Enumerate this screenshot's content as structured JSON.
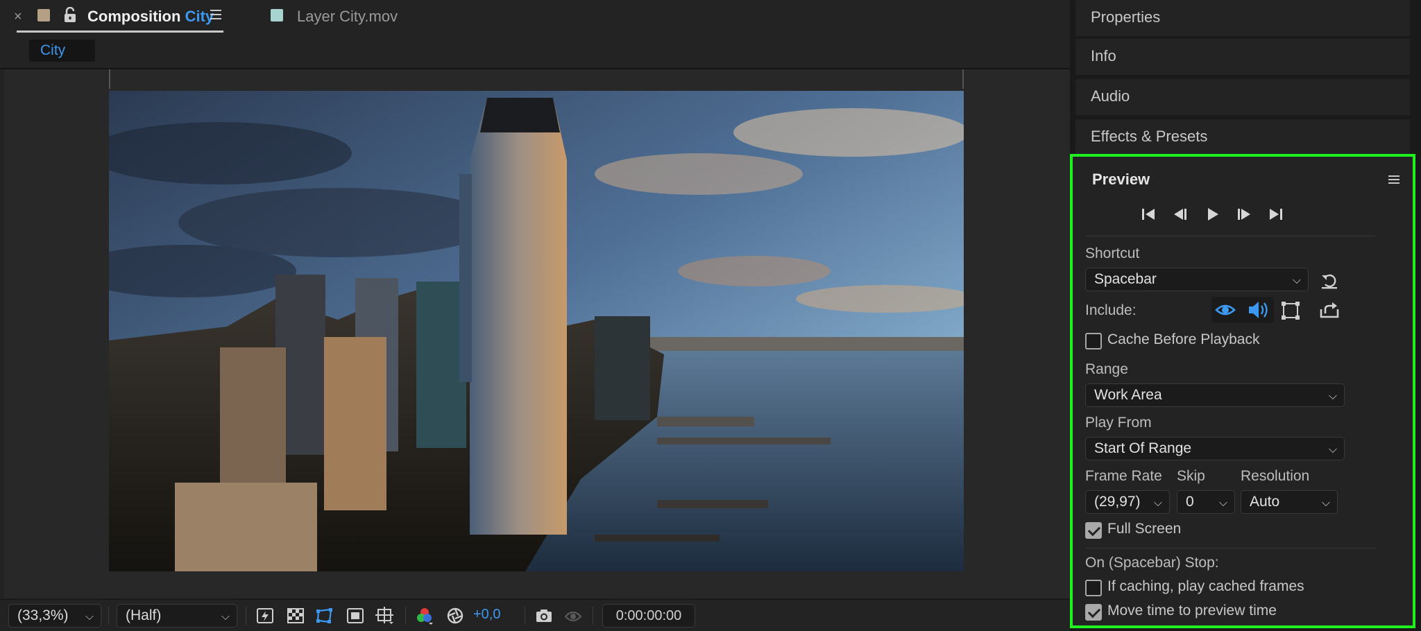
{
  "composition_tab": {
    "title_prefix": "Composition",
    "title_name": "City",
    "layer_tab_label": "Layer City.mov",
    "breadcrumb": "City"
  },
  "colors": {
    "accent_blue": "#3d98f0",
    "highlight_green": "#1ff01f",
    "comp_swatch": "#b4a084",
    "layer_swatch": "#a8d4d0"
  },
  "viewer_toolbar": {
    "magnification": "(33,3%)",
    "resolution": "(Half)",
    "exposure_offset": "+0,0",
    "timecode": "0:00:00:00"
  },
  "right_panels": {
    "collapsed": [
      "Properties",
      "Info",
      "Audio",
      "Effects & Presets"
    ]
  },
  "preview": {
    "title": "Preview",
    "shortcut_label": "Shortcut",
    "shortcut_value": "Spacebar",
    "include_label": "Include:",
    "cache_before_playback": "Cache Before Playback",
    "range_label": "Range",
    "range_value": "Work Area",
    "play_from_label": "Play From",
    "play_from_value": "Start Of Range",
    "frame_rate_label": "Frame Rate",
    "frame_rate_value": "(29,97)",
    "skip_label": "Skip",
    "skip_value": "0",
    "resolution_label": "Resolution",
    "resolution_value": "Auto",
    "full_screen": "Full Screen",
    "stop_label": "On (Spacebar) Stop:",
    "if_caching": "If caching, play cached frames",
    "move_time": "Move time to preview time",
    "checkboxes": {
      "cache_before_playback": false,
      "full_screen": true,
      "if_caching": false,
      "move_time": true
    }
  }
}
